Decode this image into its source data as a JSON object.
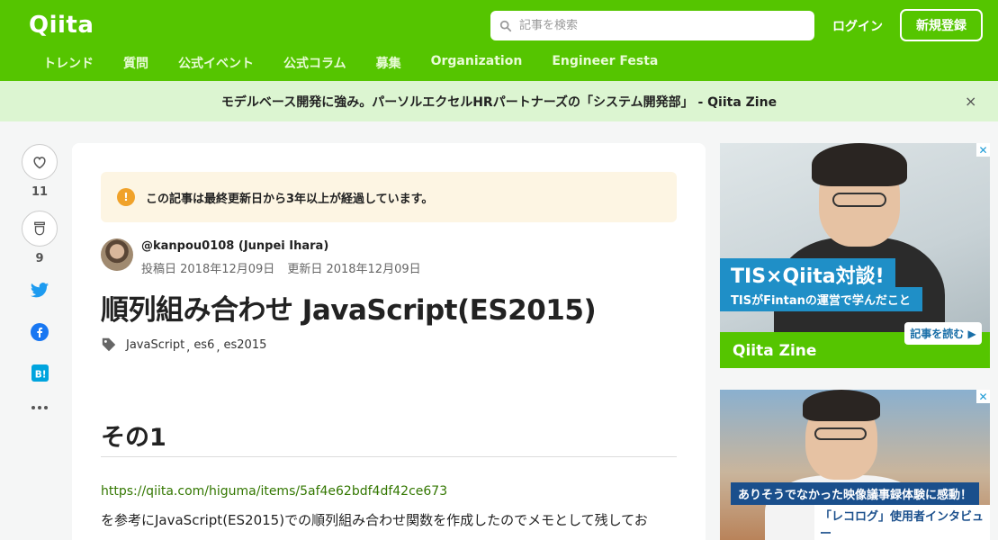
{
  "header": {
    "logo": "Qiita",
    "search_placeholder": "記事を検索",
    "login_label": "ログイン",
    "signup_label": "新規登録",
    "nav": [
      "トレンド",
      "質問",
      "公式イベント",
      "公式コラム",
      "募集",
      "Organization",
      "Engineer Festa"
    ]
  },
  "banner": {
    "text": "モデルベース開発に強み。パーソルエクセルHRパートナーズの「システム開発部」 - Qiita Zine",
    "close": "×"
  },
  "sidebar": {
    "likes_count": "11",
    "stocks_count": "9"
  },
  "article": {
    "notice": "この記事は最終更新日から3年以上が経過しています。",
    "notice_icon": "!",
    "author": "@kanpou0108 (Junpei Ihara)",
    "posted": "投稿日 2018年12月09日",
    "updated": "更新日 2018年12月09日",
    "title": "順列組み合わせ JavaScript(ES2015)",
    "tags": [
      "JavaScript",
      "es6",
      "es2015"
    ],
    "heading": "その1",
    "link": "https://qiita.com/higuma/items/5af4e62bdf4df42ce673",
    "paragraph": "を参考にJavaScript(ES2015)での順列組み合わせ関数を作成したのでメモとして残してお"
  },
  "ads": {
    "ad1_title": "TIS×Qiita対談!",
    "ad1_sub": "TISがFintanの運営で学んだこと",
    "ad1_brand": "Qiita Zine",
    "ad1_cta": "記事を読む ▶",
    "ad2_title": "ありそうでなかった映像議事録体験に感動！",
    "ad2_sub": "「レコログ」使用者インタビュー"
  },
  "colors": {
    "brand": "#55c500",
    "banner_bg": "#dcf5d1",
    "link": "#337700",
    "notice_bg": "#fdf5e3"
  }
}
